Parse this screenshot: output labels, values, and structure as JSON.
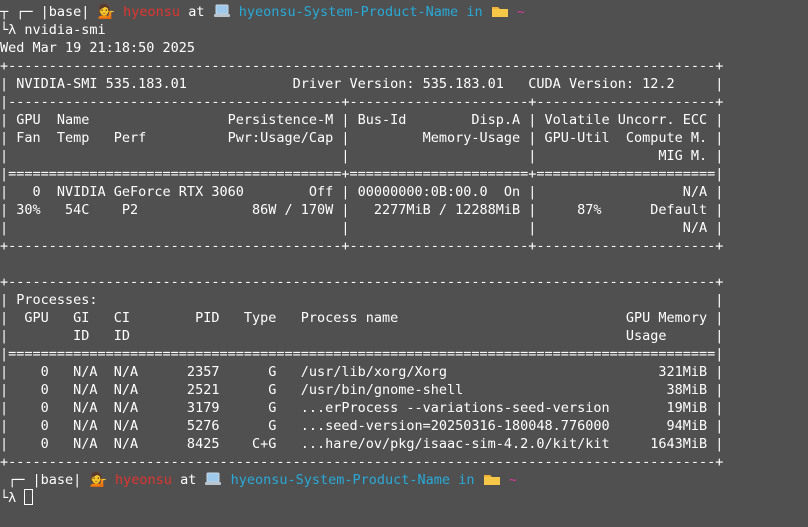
{
  "prompt": {
    "box_top": "┬ ┌─ ",
    "box_bottom": " ┌─ ",
    "env": "|base|",
    "person_emoji": "💁",
    "user": "hyeonsu",
    "at": "at",
    "host": "hyeonsu-System-Product-Name",
    "in": "in",
    "dir": "~",
    "arrow": "└λ",
    "arrow_first": "└λ",
    "command": "nvidia-smi",
    "laptop_icon": "laptop-icon",
    "folder_icon": "folder-icon"
  },
  "date_line": "Wed Mar 19 21:18:50 2025",
  "smi": {
    "rule_top": "+---------------------------------------------------------------------------------------+",
    "header": "| NVIDIA-SMI 535.183.01             Driver Version: 535.183.01   CUDA Version: 12.2     |",
    "rule_split": "|-----------------------------------------+----------------------+----------------------+",
    "col1": "| GPU  Name                 Persistence-M | Bus-Id        Disp.A | Volatile Uncorr. ECC |",
    "col2": "| Fan  Temp   Perf          Pwr:Usage/Cap |         Memory-Usage | GPU-Util  Compute M. |",
    "col3": "|                                         |                      |               MIG M. |",
    "rule_double": "|=========================================+======================+======================|",
    "gpu1": "|   0  NVIDIA GeForce RTX 3060        Off | 00000000:0B:00.0  On |                  N/A |",
    "gpu2": "| 30%   54C    P2              86W / 170W |   2277MiB / 12288MiB |     87%      Default |",
    "gpu3": "|                                         |                      |                  N/A |",
    "rule_split_end": "+-----------------------------------------+----------------------+----------------------+",
    "blank": "",
    "proc_rule_top": "+---------------------------------------------------------------------------------------+",
    "proc_title": "| Processes:                                                                            |",
    "proc_hdr1": "|  GPU   GI   CI        PID   Type   Process name                            GPU Memory |",
    "proc_hdr2": "|        ID   ID                                                             Usage      |",
    "proc_rule_double": "|=======================================================================================|",
    "processes": [
      "|    0   N/A  N/A      2357      G   /usr/lib/xorg/Xorg                          321MiB |",
      "|    0   N/A  N/A      2521      G   /usr/bin/gnome-shell                         38MiB |",
      "|    0   N/A  N/A      3179      G   ...erProcess --variations-seed-version       19MiB |",
      "|    0   N/A  N/A      5276      G   ...seed-version=20250316-180048.776000       94MiB |",
      "|    0   N/A  N/A      8425    C+G   ...hare/ov/pkg/isaac-sim-4.2.0/kit/kit     1643MiB |"
    ],
    "proc_rule_bottom": "+---------------------------------------------------------------------------------------+"
  }
}
